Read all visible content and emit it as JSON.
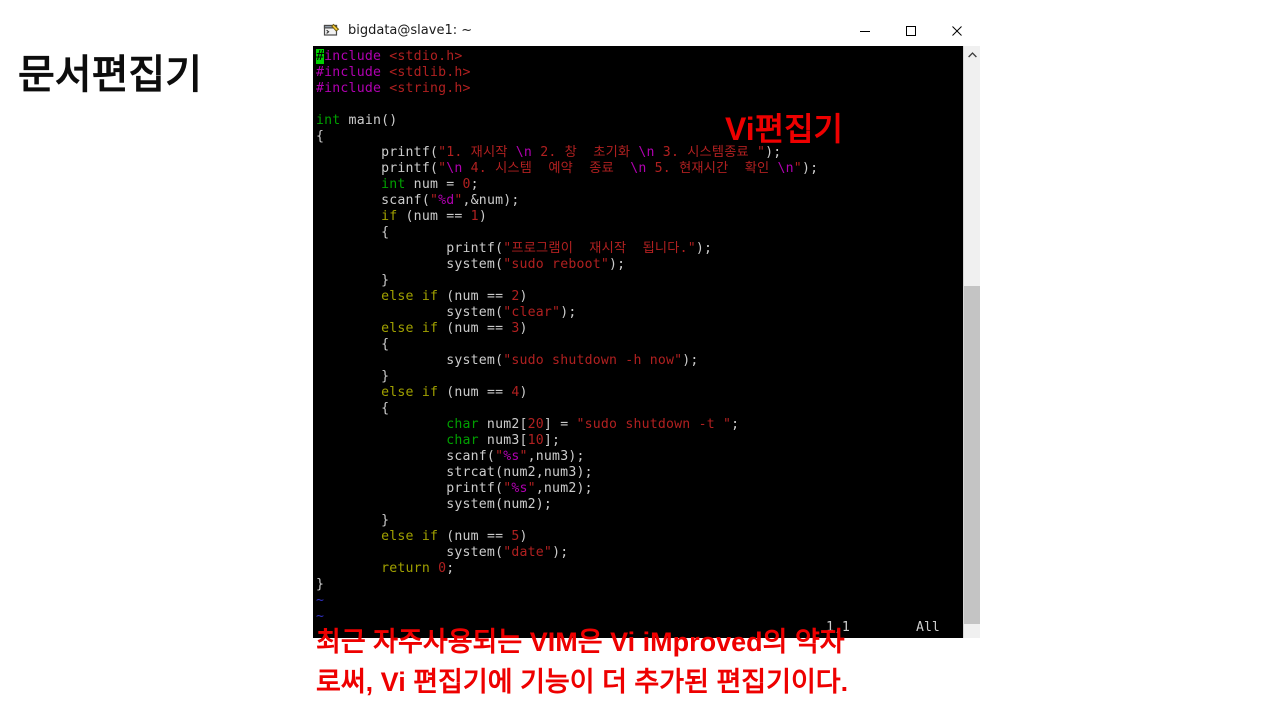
{
  "slide": {
    "heading": "문서편집기",
    "caption_line1": "최근 자주사용되는 VIM은 Vi iMproved의 약자",
    "caption_line2": "로써, Vi 편집기에 기능이 더 추가된 편집기이다.",
    "overlay_label": "Vi편집기",
    "accent_red": "#ee0000",
    "heading_color": "#0d0d0d"
  },
  "window": {
    "title": "bigdata@slave1: ~",
    "icon": "terminal-app-icon",
    "minimize_label": "—",
    "maximize_label": "▢",
    "close_label": "✕"
  },
  "scrollbar": {
    "up_arrow": "⌃"
  },
  "editor": {
    "status_position": "1,1",
    "status_scroll": "All",
    "cursor_char": "#",
    "lines": [
      {
        "id": "l1",
        "segments": [
          {
            "t": "#",
            "c": "cursor"
          },
          {
            "t": "include ",
            "c": "c-pre"
          },
          {
            "t": "<stdio.h>",
            "c": "c-str"
          }
        ]
      },
      {
        "id": "l2",
        "segments": [
          {
            "t": "#include ",
            "c": "c-pre"
          },
          {
            "t": "<stdlib.h>",
            "c": "c-str"
          }
        ]
      },
      {
        "id": "l3",
        "segments": [
          {
            "t": "#include ",
            "c": "c-pre"
          },
          {
            "t": "<string.h>",
            "c": "c-str"
          }
        ]
      },
      {
        "id": "l4",
        "segments": []
      },
      {
        "id": "l5",
        "segments": [
          {
            "t": "int",
            "c": "c-type"
          },
          {
            "t": " main()",
            "c": "c-plain"
          }
        ]
      },
      {
        "id": "l6",
        "segments": [
          {
            "t": "{",
            "c": "c-plain"
          }
        ]
      },
      {
        "id": "l7",
        "segments": [
          {
            "t": "        printf(",
            "c": "c-plain"
          },
          {
            "t": "\"1. 재시작 ",
            "c": "c-str"
          },
          {
            "t": "\\n",
            "c": "c-esc"
          },
          {
            "t": " 2. 창  초기화 ",
            "c": "c-str"
          },
          {
            "t": "\\n",
            "c": "c-esc"
          },
          {
            "t": " 3. 시스템종료 \"",
            "c": "c-str"
          },
          {
            "t": ");",
            "c": "c-plain"
          }
        ]
      },
      {
        "id": "l8",
        "segments": [
          {
            "t": "        printf(",
            "c": "c-plain"
          },
          {
            "t": "\"",
            "c": "c-str"
          },
          {
            "t": "\\n",
            "c": "c-esc"
          },
          {
            "t": " 4. 시스템  예약  종료  ",
            "c": "c-str"
          },
          {
            "t": "\\n",
            "c": "c-esc"
          },
          {
            "t": " 5. 현재시간  확인 ",
            "c": "c-str"
          },
          {
            "t": "\\n",
            "c": "c-esc"
          },
          {
            "t": "\"",
            "c": "c-str"
          },
          {
            "t": ");",
            "c": "c-plain"
          }
        ]
      },
      {
        "id": "l9",
        "segments": [
          {
            "t": "        ",
            "c": "c-plain"
          },
          {
            "t": "int",
            "c": "c-type"
          },
          {
            "t": " num = ",
            "c": "c-plain"
          },
          {
            "t": "0",
            "c": "c-num"
          },
          {
            "t": ";",
            "c": "c-plain"
          }
        ]
      },
      {
        "id": "l10",
        "segments": [
          {
            "t": "        scanf(",
            "c": "c-plain"
          },
          {
            "t": "\"",
            "c": "c-str"
          },
          {
            "t": "%d",
            "c": "c-esc"
          },
          {
            "t": "\"",
            "c": "c-str"
          },
          {
            "t": ",&num);",
            "c": "c-plain"
          }
        ]
      },
      {
        "id": "l11",
        "segments": [
          {
            "t": "        ",
            "c": "c-plain"
          },
          {
            "t": "if",
            "c": "c-kw"
          },
          {
            "t": " (num == ",
            "c": "c-plain"
          },
          {
            "t": "1",
            "c": "c-num"
          },
          {
            "t": ")",
            "c": "c-plain"
          }
        ]
      },
      {
        "id": "l12",
        "segments": [
          {
            "t": "        {",
            "c": "c-plain"
          }
        ]
      },
      {
        "id": "l13",
        "segments": [
          {
            "t": "                printf(",
            "c": "c-plain"
          },
          {
            "t": "\"프로그램이  재시작  됩니다.\"",
            "c": "c-str"
          },
          {
            "t": ");",
            "c": "c-plain"
          }
        ]
      },
      {
        "id": "l14",
        "segments": [
          {
            "t": "                system(",
            "c": "c-plain"
          },
          {
            "t": "\"sudo reboot\"",
            "c": "c-str"
          },
          {
            "t": ");",
            "c": "c-plain"
          }
        ]
      },
      {
        "id": "l15",
        "segments": [
          {
            "t": "        }",
            "c": "c-plain"
          }
        ]
      },
      {
        "id": "l16",
        "segments": [
          {
            "t": "        ",
            "c": "c-plain"
          },
          {
            "t": "else if",
            "c": "c-kw"
          },
          {
            "t": " (num == ",
            "c": "c-plain"
          },
          {
            "t": "2",
            "c": "c-num"
          },
          {
            "t": ")",
            "c": "c-plain"
          }
        ]
      },
      {
        "id": "l17",
        "segments": [
          {
            "t": "                system(",
            "c": "c-plain"
          },
          {
            "t": "\"clear\"",
            "c": "c-str"
          },
          {
            "t": ");",
            "c": "c-plain"
          }
        ]
      },
      {
        "id": "l18",
        "segments": [
          {
            "t": "        ",
            "c": "c-plain"
          },
          {
            "t": "else if",
            "c": "c-kw"
          },
          {
            "t": " (num == ",
            "c": "c-plain"
          },
          {
            "t": "3",
            "c": "c-num"
          },
          {
            "t": ")",
            "c": "c-plain"
          }
        ]
      },
      {
        "id": "l19",
        "segments": [
          {
            "t": "        {",
            "c": "c-plain"
          }
        ]
      },
      {
        "id": "l20",
        "segments": [
          {
            "t": "                system(",
            "c": "c-plain"
          },
          {
            "t": "\"sudo shutdown -h now\"",
            "c": "c-str"
          },
          {
            "t": ");",
            "c": "c-plain"
          }
        ]
      },
      {
        "id": "l21",
        "segments": [
          {
            "t": "        }",
            "c": "c-plain"
          }
        ]
      },
      {
        "id": "l22",
        "segments": [
          {
            "t": "        ",
            "c": "c-plain"
          },
          {
            "t": "else if",
            "c": "c-kw"
          },
          {
            "t": " (num == ",
            "c": "c-plain"
          },
          {
            "t": "4",
            "c": "c-num"
          },
          {
            "t": ")",
            "c": "c-plain"
          }
        ]
      },
      {
        "id": "l23",
        "segments": [
          {
            "t": "        {",
            "c": "c-plain"
          }
        ]
      },
      {
        "id": "l24",
        "segments": [
          {
            "t": "                ",
            "c": "c-plain"
          },
          {
            "t": "char",
            "c": "c-type"
          },
          {
            "t": " num2[",
            "c": "c-plain"
          },
          {
            "t": "20",
            "c": "c-num"
          },
          {
            "t": "] = ",
            "c": "c-plain"
          },
          {
            "t": "\"sudo shutdown -t \"",
            "c": "c-str"
          },
          {
            "t": ";",
            "c": "c-plain"
          }
        ]
      },
      {
        "id": "l25",
        "segments": [
          {
            "t": "                ",
            "c": "c-plain"
          },
          {
            "t": "char",
            "c": "c-type"
          },
          {
            "t": " num3[",
            "c": "c-plain"
          },
          {
            "t": "10",
            "c": "c-num"
          },
          {
            "t": "];",
            "c": "c-plain"
          }
        ]
      },
      {
        "id": "l26",
        "segments": [
          {
            "t": "                scanf(",
            "c": "c-plain"
          },
          {
            "t": "\"",
            "c": "c-str"
          },
          {
            "t": "%s",
            "c": "c-esc"
          },
          {
            "t": "\"",
            "c": "c-str"
          },
          {
            "t": ",num3);",
            "c": "c-plain"
          }
        ]
      },
      {
        "id": "l27",
        "segments": [
          {
            "t": "                strcat(num2,num3);",
            "c": "c-plain"
          }
        ]
      },
      {
        "id": "l28",
        "segments": [
          {
            "t": "                printf(",
            "c": "c-plain"
          },
          {
            "t": "\"",
            "c": "c-str"
          },
          {
            "t": "%s",
            "c": "c-esc"
          },
          {
            "t": "\"",
            "c": "c-str"
          },
          {
            "t": ",num2);",
            "c": "c-plain"
          }
        ]
      },
      {
        "id": "l29",
        "segments": [
          {
            "t": "                system(num2);",
            "c": "c-plain"
          }
        ]
      },
      {
        "id": "l30",
        "segments": [
          {
            "t": "        }",
            "c": "c-plain"
          }
        ]
      },
      {
        "id": "l31",
        "segments": [
          {
            "t": "        ",
            "c": "c-plain"
          },
          {
            "t": "else if",
            "c": "c-kw"
          },
          {
            "t": " (num == ",
            "c": "c-plain"
          },
          {
            "t": "5",
            "c": "c-num"
          },
          {
            "t": ")",
            "c": "c-plain"
          }
        ]
      },
      {
        "id": "l32",
        "segments": [
          {
            "t": "                system(",
            "c": "c-plain"
          },
          {
            "t": "\"date\"",
            "c": "c-str"
          },
          {
            "t": ");",
            "c": "c-plain"
          }
        ]
      },
      {
        "id": "l33",
        "segments": [
          {
            "t": "        ",
            "c": "c-plain"
          },
          {
            "t": "return",
            "c": "c-kw"
          },
          {
            "t": " ",
            "c": "c-plain"
          },
          {
            "t": "0",
            "c": "c-num"
          },
          {
            "t": ";",
            "c": "c-plain"
          }
        ]
      },
      {
        "id": "l34",
        "segments": [
          {
            "t": "}",
            "c": "c-plain"
          }
        ]
      },
      {
        "id": "l35",
        "segments": [
          {
            "t": "~",
            "c": "c-tilde"
          }
        ]
      },
      {
        "id": "l36",
        "segments": [
          {
            "t": "~",
            "c": "c-tilde"
          }
        ]
      }
    ]
  }
}
